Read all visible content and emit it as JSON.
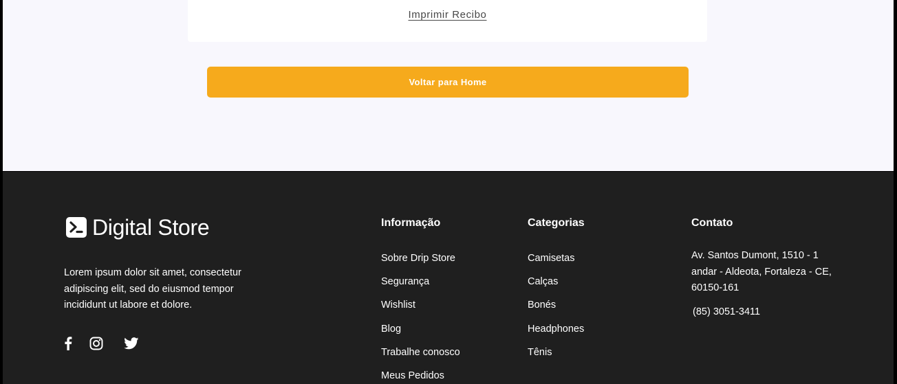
{
  "receipt": {
    "print_label": "Imprimir Recibo"
  },
  "actions": {
    "home_button_label": "Voltar para Home"
  },
  "footer": {
    "brand": {
      "name": "Digital Store",
      "icon": "terminal-logo-icon",
      "description": "Lorem ipsum dolor sit amet, consectetur adipiscing elit, sed do eiusmod tempor incididunt ut labore et dolore."
    },
    "socials": [
      {
        "icon": "facebook-icon"
      },
      {
        "icon": "instagram-icon"
      },
      {
        "icon": "twitter-icon"
      }
    ],
    "info": {
      "title": "Informação",
      "items": [
        "Sobre Drip Store",
        "Segurança",
        "Wishlist",
        "Blog",
        "Trabalhe conosco",
        "Meus Pedidos"
      ]
    },
    "categories": {
      "title": "Categorias",
      "items": [
        "Camisetas",
        "Calças",
        "Bonés",
        "Headphones",
        "Tênis"
      ]
    },
    "contact": {
      "title": "Contato",
      "address": "Av. Santos Dumont, 1510 - 1 andar - Aldeota, Fortaleza - CE, 60150-161",
      "phone": "(85) 3051-3411"
    }
  },
  "colors": {
    "accent": "#F6AA1C",
    "footer_bg": "#1F1F1F",
    "page_bg": "#F8F7FD"
  }
}
